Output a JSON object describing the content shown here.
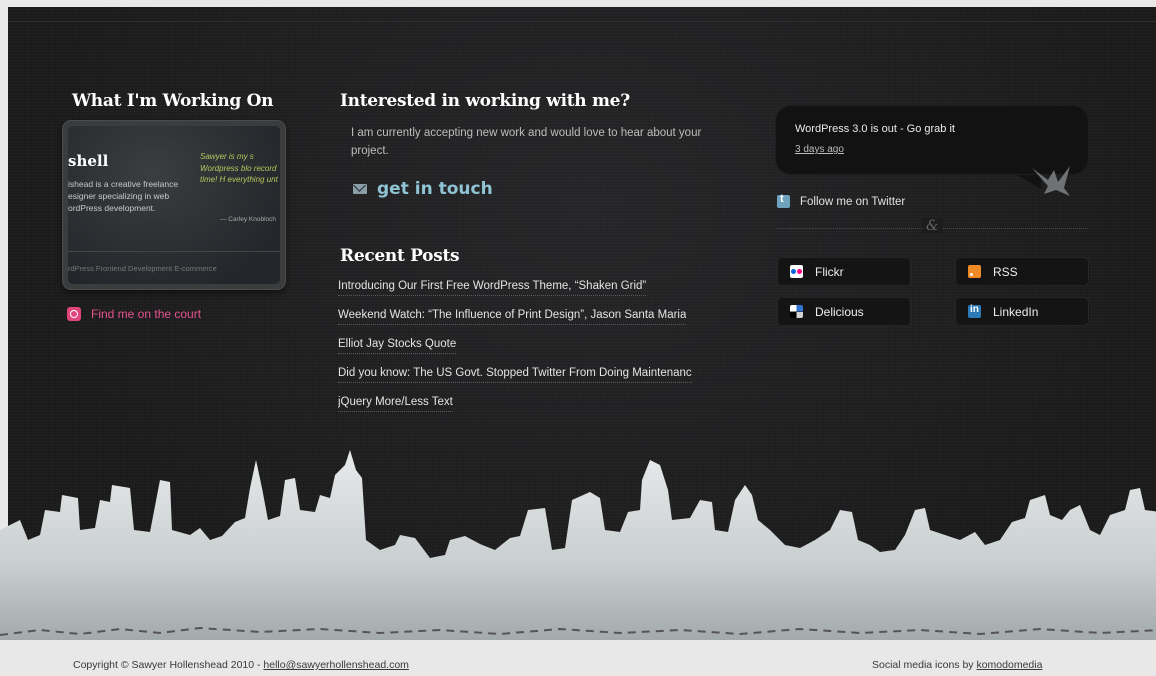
{
  "left": {
    "heading": "What I'm Working On",
    "card": {
      "title": "shell",
      "description": "ishead is a creative freelance esigner specializing in web ordPress development.",
      "quote": "Sawyer is my s Wordpress blo record time! H everything unt",
      "quote_author": "— Carley Knobloch",
      "tags": "rdPress   Frontend Development   E-commerce"
    },
    "court_link": "Find me on the court"
  },
  "middle": {
    "heading": "Interested in working with me?",
    "intro": "I am currently accepting new work and would love to hear about your project.",
    "cta": "get in touch",
    "recent_heading": "Recent Posts",
    "posts": [
      "Introducing Our First Free WordPress Theme, “Shaken Grid”",
      "Weekend Watch: “The Influence of Print Design”, Jason Santa Maria",
      "Elliot Jay Stocks Quote",
      "Did you know: The US Govt. Stopped Twitter From Doing Maintenanc",
      "jQuery More/Less Text"
    ]
  },
  "right": {
    "tweet": "WordPress 3.0 is out - Go grab it",
    "tweet_time": "3 days ago",
    "follow": "Follow me on Twitter",
    "amp": "&",
    "social": {
      "flickr": "Flickr",
      "rss": "RSS",
      "delicious": "Delicious",
      "linkedin": "LinkedIn"
    }
  },
  "footer": {
    "copyright": "Copyright © Sawyer Hollenshead 2010 - ",
    "email": "hello@sawyerhollenshead.com",
    "credits": "Social media icons by ",
    "credits_link": "komodomedia"
  },
  "colors": {
    "background": "#1c1c1d",
    "accent_blue": "#8fc4d4",
    "accent_pink": "#e6538d",
    "footer_bg": "#e8e8e8"
  }
}
